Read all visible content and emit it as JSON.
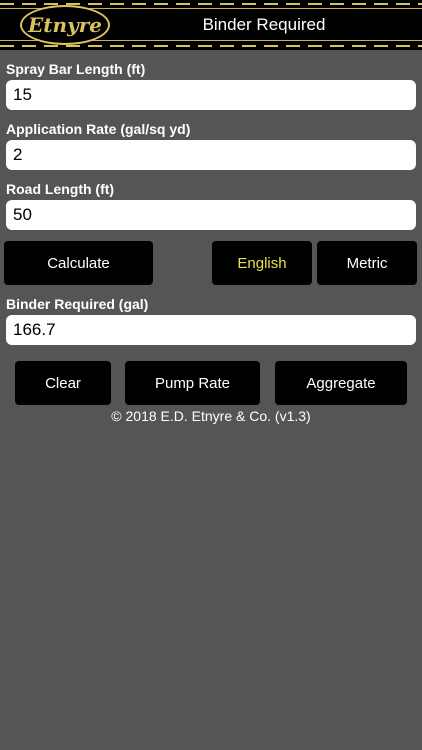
{
  "header": {
    "logo_text": "Etnyre",
    "title": "Binder Required"
  },
  "form": {
    "spray_bar_length": {
      "label": "Spray Bar Length  (ft)",
      "value": "15"
    },
    "application_rate": {
      "label": "Application Rate  (gal/sq yd)",
      "value": "2"
    },
    "road_length": {
      "label": "Road Length  (ft)",
      "value": "50"
    },
    "binder_required": {
      "label": "Binder Required  (gal)",
      "value": "166.7"
    }
  },
  "buttons": {
    "calculate": "Calculate",
    "english": "English",
    "metric": "Metric",
    "clear": "Clear",
    "pump_rate": "Pump Rate",
    "aggregate": "Aggregate"
  },
  "colors": {
    "background": "#555555",
    "active_unit": "#e8e04a",
    "stripe_gold": "#d8c25a"
  },
  "footer": {
    "copyright": "© 2018 E.D. Etnyre & Co. (v1.3)"
  }
}
